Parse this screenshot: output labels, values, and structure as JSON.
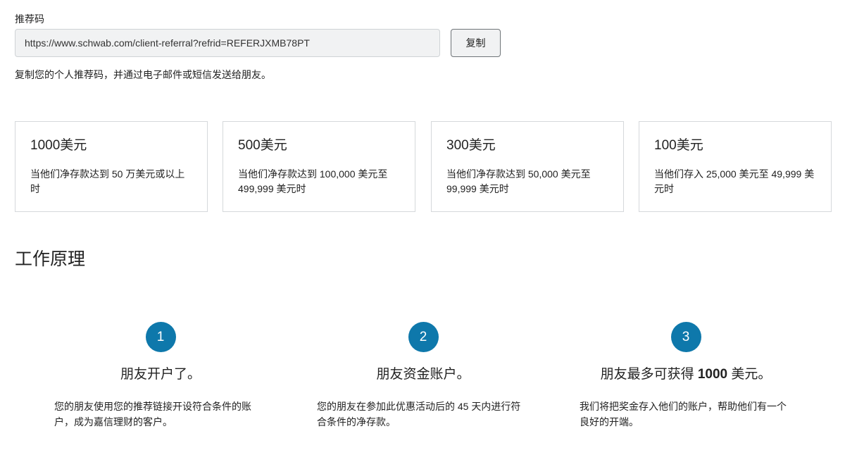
{
  "referral": {
    "label": "推荐码",
    "url": "https://www.schwab.com/client-referral?refrid=REFERJXMB78PT",
    "copy_label": "复制",
    "helper_text": "复制您的个人推荐码，并通过电子邮件或短信发送给朋友。"
  },
  "tiers": [
    {
      "amount": "1000美元",
      "description": "当他们净存款达到 50 万美元或以上时"
    },
    {
      "amount": "500美元",
      "description": "当他们净存款达到 100,000 美元至 499,999 美元时"
    },
    {
      "amount": "300美元",
      "description": "当他们净存款达到 50,000 美元至 99,999 美元时"
    },
    {
      "amount": "100美元",
      "description": "当他们存入 25,000 美元至 49,999 美元时"
    }
  ],
  "how_it_works": {
    "title": "工作原理",
    "steps": [
      {
        "number": "1",
        "title": "朋友开户了。",
        "description": "您的朋友使用您的推荐链接开设符合条件的账户，成为嘉信理财的客户。"
      },
      {
        "number": "2",
        "title": "朋友资金账户。",
        "description": "您的朋友在参加此优惠活动后的 45 天内进行符合条件的净存款。"
      },
      {
        "number": "3",
        "title_prefix": "朋友最多可获得 ",
        "title_bold": "1000",
        "title_suffix": " 美元。",
        "description": "我们将把奖金存入他们的账户，帮助他们有一个良好的开端。"
      }
    ]
  },
  "colors": {
    "accent": "#0e78ab",
    "card_border": "#d5d8db",
    "input_bg": "#f1f2f3"
  }
}
